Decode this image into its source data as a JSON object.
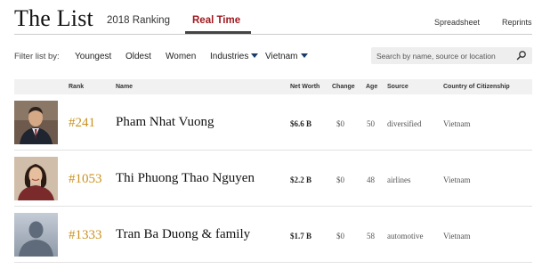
{
  "header": {
    "title": "The List",
    "tabs": [
      {
        "label": "2018 Ranking",
        "active": false
      },
      {
        "label": "Real Time",
        "active": true
      }
    ],
    "links": {
      "spreadsheet": "Spreadsheet",
      "reprints": "Reprints"
    },
    "accent_color": "#a0191f"
  },
  "filters": {
    "label": "Filter list by:",
    "options": [
      "Youngest",
      "Oldest",
      "Women"
    ],
    "industries": "Industries",
    "country": "Vietnam",
    "search_placeholder": "Search by name, source or location"
  },
  "table": {
    "columns": [
      "Rank",
      "Name",
      "Net Worth",
      "Change",
      "Age",
      "Source",
      "Country of Citizenship"
    ],
    "rows": [
      {
        "rank": "#241",
        "name": "Pham Nhat Vuong",
        "net_worth": "$6.6 B",
        "change": "$0",
        "age": "50",
        "source": "diversified",
        "country": "Vietnam",
        "avatar": "man-in-suit-photo"
      },
      {
        "rank": "#1053",
        "name": "Thi Phuong Thao Nguyen",
        "net_worth": "$2.2 B",
        "change": "$0",
        "age": "48",
        "source": "airlines",
        "country": "Vietnam",
        "avatar": "woman-portrait-photo"
      },
      {
        "rank": "#1333",
        "name": "Tran Ba Duong & family",
        "net_worth": "$1.7 B",
        "change": "$0",
        "age": "58",
        "source": "automotive",
        "country": "Vietnam",
        "avatar": "placeholder-silhouette"
      }
    ],
    "rank_color": "#c9921f"
  }
}
